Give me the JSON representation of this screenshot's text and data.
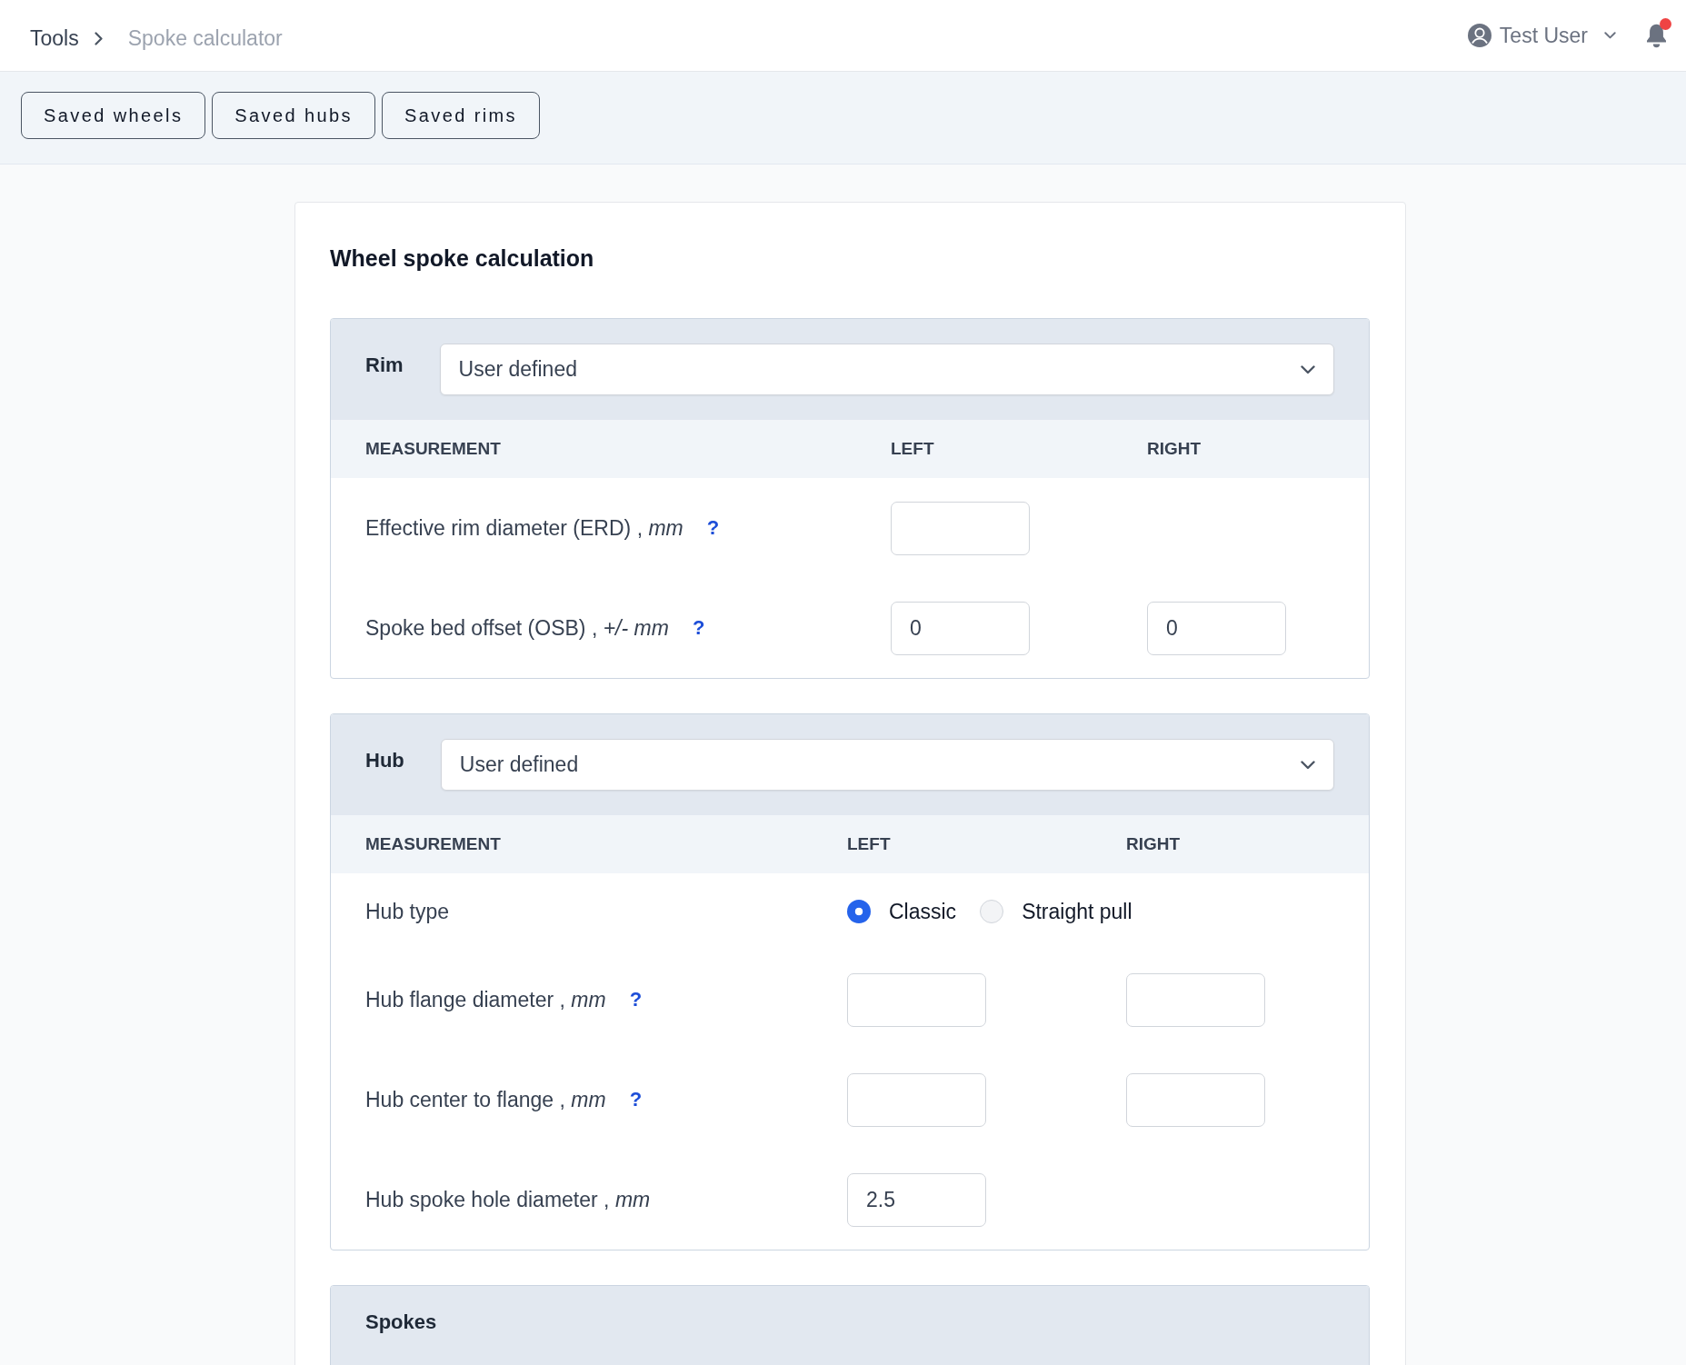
{
  "breadcrumb": [
    {
      "label": "Tools",
      "current": false
    },
    {
      "label": "Spoke calculator",
      "current": true
    }
  ],
  "user": {
    "name": "Test User"
  },
  "notifications": {
    "unread": true
  },
  "toolbar": {
    "buttons": [
      "Saved wheels",
      "Saved hubs",
      "Saved rims"
    ]
  },
  "card": {
    "title": "Wheel spoke calculation",
    "sections": [
      {
        "label": "Rim",
        "select": {
          "value": "User defined"
        },
        "columns": [
          "MEASUREMENT",
          "LEFT",
          "RIGHT"
        ],
        "rows": [
          {
            "kind": "inputs",
            "label": "Effective rim diameter (ERD) , *mm*",
            "help": "?",
            "left": {}
          },
          {
            "kind": "inputs",
            "label": "Spoke bed offset (OSB) , *+/- mm*",
            "help": "?",
            "left": {
              "value": "0"
            },
            "right": {
              "value": "0"
            }
          }
        ]
      },
      {
        "label": "Hub",
        "select": {
          "value": "User defined"
        },
        "columns": [
          "MEASUREMENT",
          "LEFT",
          "RIGHT"
        ],
        "rows": [
          {
            "kind": "radio",
            "label": "Hub type",
            "options": [
              {
                "label": "Classic",
                "selected": true
              },
              {
                "label": "Straight pull",
                "selected": false
              }
            ]
          },
          {
            "kind": "inputs",
            "label": "Hub flange diameter , *mm*",
            "help": "?",
            "left": {},
            "right": {}
          },
          {
            "kind": "inputs",
            "label": "Hub center to flange , *mm*",
            "help": "?",
            "left": {},
            "right": {}
          },
          {
            "kind": "inputs",
            "label": "Hub spoke hole diameter , *mm*",
            "left": {
              "value": "2.5"
            }
          }
        ]
      },
      {
        "label": "Spokes"
      }
    ]
  }
}
